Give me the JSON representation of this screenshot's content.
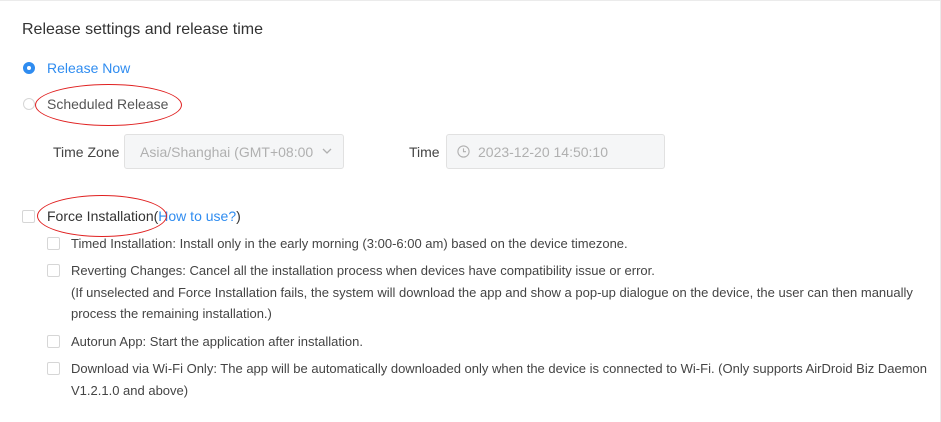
{
  "section_title": "Release settings and release time",
  "release_options": {
    "release_now": "Release Now",
    "scheduled_release": "Scheduled Release"
  },
  "schedule": {
    "timezone_label": "Time Zone",
    "timezone_value": "Asia/Shanghai (GMT+08:00",
    "time_label": "Time",
    "time_value": "2023-12-20 14:50:10"
  },
  "force_installation": {
    "label": "Force Installation",
    "help_link": "How to use?",
    "open_paren": "(",
    "close_paren": ")"
  },
  "options": [
    {
      "lines": [
        "Timed Installation: Install only in the early morning (3:00-6:00 am) based on the device timezone."
      ]
    },
    {
      "lines": [
        "Reverting Changes: Cancel all the installation process when devices have compatibility issue or error.",
        "(If unselected and Force Installation fails, the system will download the app and show a pop-up dialogue on the device, the user can then manually process the remaining installation.)"
      ]
    },
    {
      "lines": [
        "Autorun App: Start the application after installation."
      ]
    },
    {
      "lines": [
        "Download via Wi-Fi Only: The app will be automatically downloaded only when the device is connected to Wi-Fi. (Only supports AirDroid Biz Daemon V1.2.1.0 and above)"
      ]
    }
  ],
  "colors": {
    "accent": "#2f8cf0",
    "annotation": "#e02020"
  }
}
